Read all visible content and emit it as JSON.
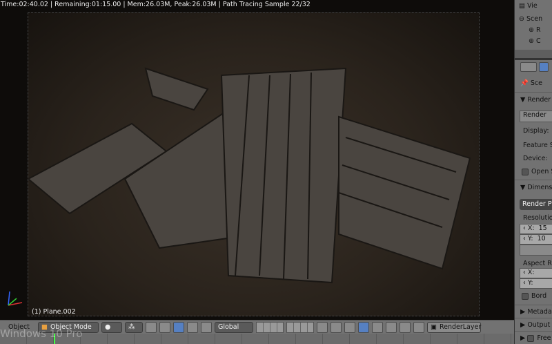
{
  "viewport": {
    "stats": "Time:02:40.02 | Remaining:01:15.00 | Mem:26.03M, Peak:26.03M | Path Tracing Sample 22/32",
    "active_object": "(1) Plane.002"
  },
  "header": {
    "menu_object": "Object",
    "mode": "Object Mode",
    "orientation": "Global",
    "render_layer": "RenderLayer"
  },
  "watermark": "Windows 10 Pro",
  "outliner": {
    "view_label": "Vie",
    "scene": "Scen",
    "items": [
      "R",
      "C"
    ]
  },
  "properties": {
    "scene_label": "Sce",
    "render_panel": "Render",
    "render_button": "Render",
    "display": "Display:",
    "feature_set": "Feature Se",
    "device": "Device:",
    "open_shading": "Open S",
    "dimensions_panel": "Dimens",
    "render_presets": "Render Pre",
    "resolution": "Resolution",
    "res_x_label": "X:",
    "res_x": "15",
    "res_y_label": "Y:",
    "res_y": "10",
    "aspect": "Aspect Rat",
    "asp_x_label": "X:",
    "asp_y_label": "Y:",
    "border": "Bord",
    "metadata_panel": "Metadat",
    "output_panel": "Output",
    "freestyle_panel": "Free"
  }
}
